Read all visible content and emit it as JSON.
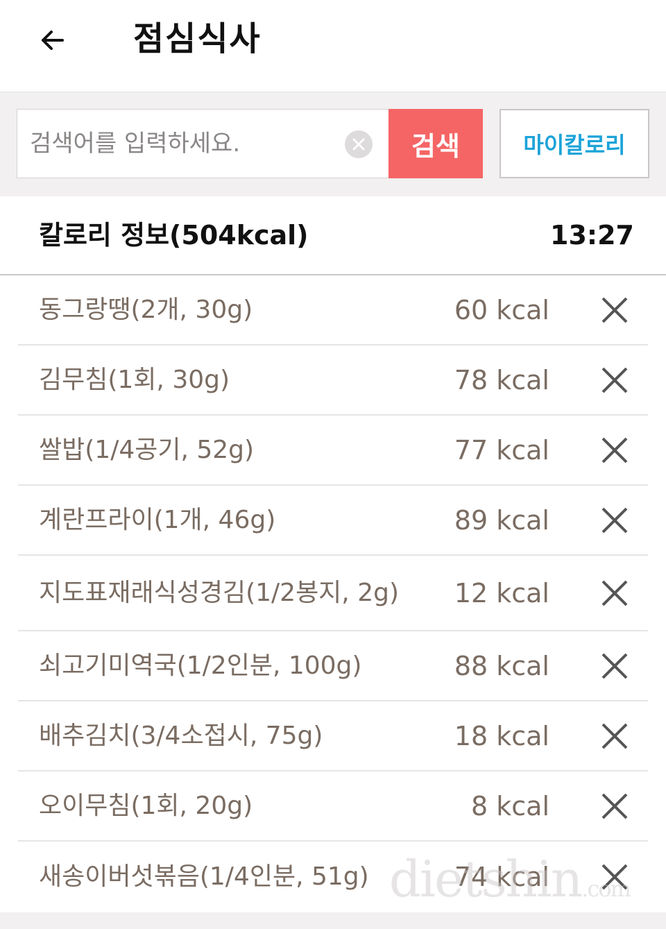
{
  "header": {
    "title": "점심식사",
    "back_icon": "arrow-left-icon"
  },
  "search": {
    "placeholder": "검색어를 입력하세요.",
    "value": "",
    "button_label": "검색",
    "my_calorie_label": "마이칼로리",
    "button_color": "#f56565",
    "my_calorie_color": "#1ba3d8"
  },
  "calorie_info": {
    "title": "칼로리 정보(504kcal)",
    "time": "13:27"
  },
  "foods": [
    {
      "name": "동그랑땡(2개, 30g)",
      "kcal": "60 kcal"
    },
    {
      "name": "김무침(1회, 30g)",
      "kcal": "78 kcal"
    },
    {
      "name": "쌀밥(1/4공기, 52g)",
      "kcal": "77 kcal"
    },
    {
      "name": "계란프라이(1개, 46g)",
      "kcal": "89 kcal"
    },
    {
      "name": "지도표재래식성경김(1/2봉지, 2g)",
      "kcal": "12 kcal"
    },
    {
      "name": "쇠고기미역국(1/2인분, 100g)",
      "kcal": "88 kcal"
    },
    {
      "name": "배추김치(3/4소접시, 75g)",
      "kcal": "18 kcal"
    },
    {
      "name": "오이무침(1회, 20g)",
      "kcal": "8 kcal"
    },
    {
      "name": "새송이버섯볶음(1/4인분, 51g)",
      "kcal": "74 kcal"
    }
  ],
  "watermark": {
    "main": "dietshin",
    "suffix": ".com"
  }
}
